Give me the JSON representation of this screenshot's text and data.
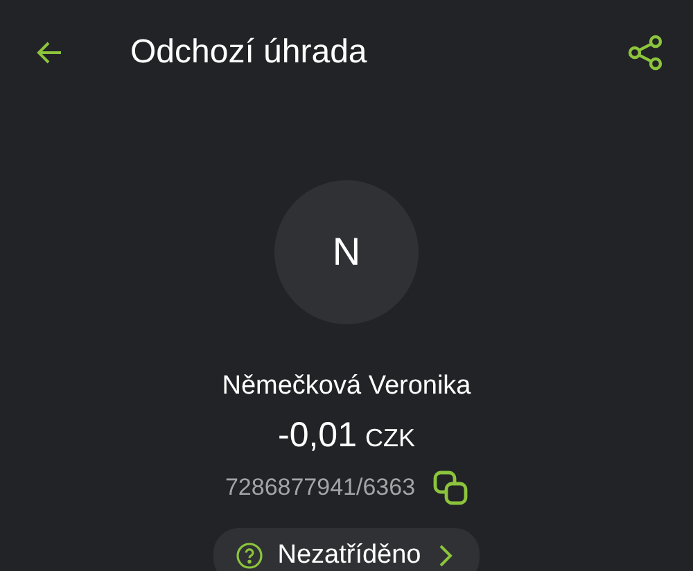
{
  "header": {
    "title": "Odchozí úhrada"
  },
  "counterparty": {
    "initial": "N",
    "name": "Němečková Veronika",
    "amount": "-0,01",
    "currency": "CZK",
    "account": "7286877941/6363"
  },
  "category": {
    "label": "Nezatříděno"
  }
}
